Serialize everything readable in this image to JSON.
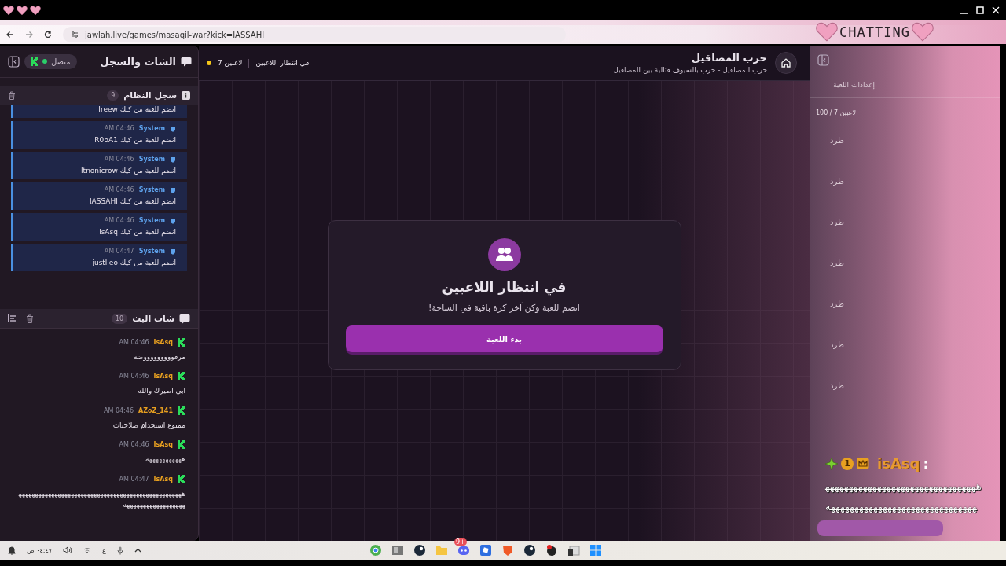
{
  "browser": {
    "url": "jawlah.live/games/masaqil-war?kick=IASSAHI"
  },
  "sidebar": {
    "title": "الشات والسجل",
    "status": "متصل",
    "connected": true,
    "system_log": {
      "title": "سجل النظام",
      "count": "9",
      "entries": [
        {
          "text": "Ireew انضم للعبة من كيك"
        },
        {
          "sender": "System",
          "time": "AM 04:46",
          "text": "R0bA1 انضم للعبة من كيك"
        },
        {
          "sender": "System",
          "time": "AM 04:46",
          "text": "Itnonicrow انضم للعبة من كيك"
        },
        {
          "sender": "System",
          "time": "AM 04:46",
          "text": "IASSAHI انضم للعبة من كيك"
        },
        {
          "sender": "System",
          "time": "AM 04:46",
          "text": "isAsq انضم للعبة من كيك"
        },
        {
          "sender": "System",
          "time": "AM 04:47",
          "text": "justlieo انضم للعبة من كيك"
        }
      ]
    },
    "stream_chat": {
      "title": "شات البث",
      "count": "10",
      "messages": [
        {
          "user": "IsAsq",
          "time": "AM 04:46",
          "text": "مرفوووووووووضه"
        },
        {
          "user": "IsAsq",
          "time": "AM 04:46",
          "text": "ابي اطيرك والله"
        },
        {
          "user": "AZoZ_141",
          "time": "AM 04:46",
          "text": "ممنوع استخدام صلاحيات"
        },
        {
          "user": "IsAsq",
          "time": "AM 04:46",
          "text": "هههههههههههه"
        },
        {
          "user": "IsAsq",
          "time": "AM 04:47",
          "text": "هههههههههههههههههههههههههههههههههههههههههههههههههههههههههههههههههههههه"
        }
      ]
    }
  },
  "game": {
    "title": "حرب المصاقيل",
    "subtitle": "حرب المصاقيل - حرب بالسيوف قتالية بين المصاقيل",
    "players": "7 لاعبين",
    "status": "في انتظار اللاعبين",
    "card": {
      "title": "في انتظار اللاعبين",
      "text": "انضم للعبة وكن آخر كرة باقية في الساحة!",
      "button": "بدء اللعبة"
    }
  },
  "settings_panel": {
    "tabs": [
      {
        "label": "إعدادات اللعبة",
        "selected": false
      }
    ],
    "player_count": "100 / 7 لاعبين",
    "players": [
      {
        "action": "طرد"
      },
      {
        "action": "طرد"
      },
      {
        "action": "طرد"
      },
      {
        "action": "طرد"
      },
      {
        "action": "طرد"
      },
      {
        "action": "طرد"
      },
      {
        "action": "طرد"
      }
    ]
  },
  "overlay": {
    "label": "CHATTING",
    "chat": {
      "badge": "1",
      "user": "isAsq",
      "separator": ":",
      "text": "ههههههههههههههههههههههههههههههههههههههههههههههههههههههههههههههههه"
    }
  },
  "taskbar": {
    "time": "٠٤:٤٧ ص",
    "input_language": "ع",
    "notification_badge": "9+"
  }
}
